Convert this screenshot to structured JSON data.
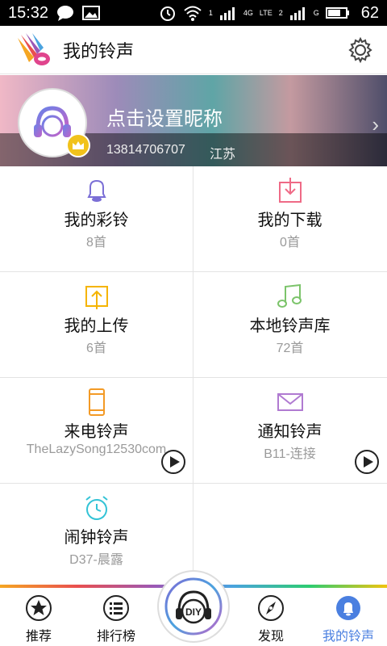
{
  "status_bar": {
    "time": "15:32",
    "battery": "62",
    "signal_1_label": "1",
    "signal_2_label": "2",
    "network_4g": "4G",
    "network_lte": "LTE",
    "network_g": "G"
  },
  "header": {
    "title": "我的铃声"
  },
  "profile": {
    "nickname": "点击设置昵称",
    "phone": "13814706707",
    "region": "江苏"
  },
  "grid": [
    {
      "label": "我的彩铃",
      "sub": "8首",
      "icon": "bell-icon",
      "color": "#7b6fd6"
    },
    {
      "label": "我的下载",
      "sub": "0首",
      "icon": "download-icon",
      "color": "#ef6a86"
    },
    {
      "label": "我的上传",
      "sub": "6首",
      "icon": "upload-icon",
      "color": "#f5b400"
    },
    {
      "label": "本地铃声库",
      "sub": "72首",
      "icon": "music-note-icon",
      "color": "#7cc46b"
    },
    {
      "label": "来电铃声",
      "sub": "TheLazySong12530com",
      "icon": "phone-icon",
      "color": "#f39a25"
    },
    {
      "label": "通知铃声",
      "sub": "B11-连接",
      "icon": "envelope-icon",
      "color": "#b07ad1"
    },
    {
      "label": "闹钟铃声",
      "sub": "D37-晨露",
      "icon": "alarm-clock-icon",
      "color": "#33c3d6"
    }
  ],
  "bottom_nav": [
    {
      "label": "推荐",
      "icon": "star-icon"
    },
    {
      "label": "排行榜",
      "icon": "list-icon"
    },
    {
      "label": "DIY",
      "icon": "diy-headphones-icon"
    },
    {
      "label": "发现",
      "icon": "compass-icon"
    },
    {
      "label": "我的铃声",
      "icon": "user-bell-icon",
      "active": true
    }
  ]
}
